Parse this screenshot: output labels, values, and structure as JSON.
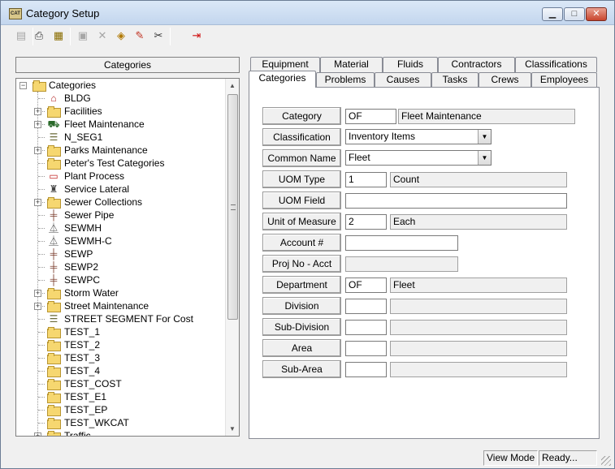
{
  "window": {
    "title": "Category Setup",
    "icon": "app-icon",
    "icon_text": "CAT",
    "controls": {
      "minimize": "minimize-icon",
      "maximize": "maximize-icon",
      "close": "close-icon"
    }
  },
  "toolbar": {
    "buttons": [
      {
        "name": "new-button",
        "icon": "new-icon",
        "enabled": false
      },
      {
        "name": "print-button",
        "icon": "print-icon",
        "enabled": true
      },
      {
        "name": "report-button",
        "icon": "report-icon",
        "enabled": true
      },
      {
        "name": "save-button",
        "icon": "save-icon",
        "enabled": false
      },
      {
        "name": "delete-button",
        "icon": "delete-icon",
        "enabled": false
      },
      {
        "name": "layers-button",
        "icon": "layers-icon",
        "enabled": true
      },
      {
        "name": "edit-button",
        "icon": "pencil-icon",
        "enabled": true
      },
      {
        "name": "cut-button",
        "icon": "scissors-icon",
        "enabled": true
      },
      {
        "name": "exit-button",
        "icon": "exit-icon",
        "enabled": true
      }
    ]
  },
  "categories_panel": {
    "header": "Categories",
    "tree": {
      "root": {
        "label": "Categories",
        "expanded": true
      },
      "items": [
        {
          "label": "BLDG",
          "icon": "building-icon",
          "expandable": false
        },
        {
          "label": "Facilities",
          "icon": "folder-icon",
          "expandable": true
        },
        {
          "label": "Fleet Maintenance",
          "icon": "truck-icon",
          "expandable": true
        },
        {
          "label": "N_SEG1",
          "icon": "road-icon",
          "expandable": false
        },
        {
          "label": "Parks Maintenance",
          "icon": "folder-icon",
          "expandable": true
        },
        {
          "label": "Peter's Test Categories",
          "icon": "folder-icon",
          "expandable": false
        },
        {
          "label": "Plant Process",
          "icon": "document-icon",
          "expandable": false
        },
        {
          "label": "Service Lateral",
          "icon": "pipe-fitting-icon",
          "expandable": false
        },
        {
          "label": "Sewer Collections",
          "icon": "folder-icon",
          "expandable": true
        },
        {
          "label": "Sewer Pipe",
          "icon": "sewer-pipe-icon",
          "expandable": false
        },
        {
          "label": "SEWMH",
          "icon": "manhole-icon",
          "expandable": false
        },
        {
          "label": "SEWMH-C",
          "icon": "manhole-icon",
          "expandable": false
        },
        {
          "label": "SEWP",
          "icon": "sewer-pipe-icon",
          "expandable": false
        },
        {
          "label": "SEWP2",
          "icon": "sewer-pipe-icon",
          "expandable": false
        },
        {
          "label": "SEWPC",
          "icon": "sewer-pipe-icon",
          "expandable": false
        },
        {
          "label": "Storm Water",
          "icon": "folder-icon",
          "expandable": true
        },
        {
          "label": "Street Maintenance",
          "icon": "folder-icon",
          "expandable": true
        },
        {
          "label": "STREET SEGMENT For Cost",
          "icon": "road-icon",
          "expandable": false
        },
        {
          "label": "TEST_1",
          "icon": "folder-icon",
          "expandable": false
        },
        {
          "label": "TEST_2",
          "icon": "folder-icon",
          "expandable": false
        },
        {
          "label": "TEST_3",
          "icon": "folder-icon",
          "expandable": false
        },
        {
          "label": "TEST_4",
          "icon": "folder-icon",
          "expandable": false
        },
        {
          "label": "TEST_COST",
          "icon": "folder-icon",
          "expandable": false
        },
        {
          "label": "TEST_E1",
          "icon": "folder-icon",
          "expandable": false
        },
        {
          "label": "TEST_EP",
          "icon": "folder-icon",
          "expandable": false
        },
        {
          "label": "TEST_WKCAT",
          "icon": "folder-icon",
          "expandable": false
        },
        {
          "label": "Traffic",
          "icon": "folder-icon",
          "expandable": true
        }
      ]
    }
  },
  "tabs": {
    "back_row": [
      "Equipment",
      "Material",
      "Fluids",
      "Contractors",
      "Classifications"
    ],
    "front_row": [
      "Categories",
      "Problems",
      "Causes",
      "Tasks",
      "Crews",
      "Employees"
    ],
    "active": "Categories"
  },
  "form": {
    "category": {
      "label": "Category",
      "code": "OF",
      "description": "Fleet Maintenance"
    },
    "classification": {
      "label": "Classification",
      "value": "Inventory Items"
    },
    "common_name": {
      "label": "Common  Name",
      "value": "Fleet"
    },
    "uom_type": {
      "label": "UOM Type",
      "code": "1",
      "description": "Count"
    },
    "uom_field": {
      "label": "UOM Field",
      "value": ""
    },
    "unit_of_measure": {
      "label": "Unit of Measure",
      "code": "2",
      "description": "Each"
    },
    "account": {
      "label": "Account #",
      "value": ""
    },
    "proj_no_acct": {
      "label": "Proj No - Acct",
      "value": ""
    },
    "department": {
      "label": "Department",
      "code": "OF",
      "description": "Fleet"
    },
    "division": {
      "label": "Division",
      "code": "",
      "description": ""
    },
    "sub_division": {
      "label": "Sub-Division",
      "code": "",
      "description": ""
    },
    "area": {
      "label": "Area",
      "code": "",
      "description": ""
    },
    "sub_area": {
      "label": "Sub-Area",
      "code": "",
      "description": ""
    }
  },
  "statusbar": {
    "mode": "View Mode",
    "status": "Ready..."
  },
  "colors": {
    "window_bg": "#f0f0f0",
    "title_gradient_top": "#dbe8f7",
    "close_red": "#c8452d",
    "folder_yellow": "#f6d770"
  }
}
